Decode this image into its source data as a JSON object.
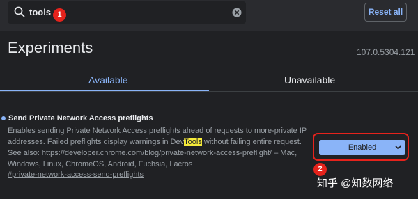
{
  "search": {
    "value": "tools"
  },
  "header": {
    "reset_label": "Reset all"
  },
  "annotations": {
    "badge_1": "1",
    "badge_2": "2"
  },
  "page": {
    "title": "Experiments",
    "version": "107.0.5304.121"
  },
  "tabs": [
    {
      "label": "Available",
      "active": true
    },
    {
      "label": "Unavailable",
      "active": false
    }
  ],
  "experiment": {
    "title": "Send Private Network Access preflights",
    "description_before": "Enables sending Private Network Access preflights ahead of requests to more-private IP addresses. Failed preflights display warnings in Dev",
    "description_highlight": "Tools",
    "description_after": " without failing entire request. See also: https://developer.chrome.com/blog/private-network-access-preflight/ – Mac, Windows, Linux, ChromeOS, Android, Fuchsia, Lacros",
    "link": "#private-network-access-send-preflights",
    "selected_option": "Enabled"
  },
  "watermark": "知乎 @知数网络",
  "colors": {
    "accent": "#8ab4f8",
    "background": "#202124",
    "annotation": "#e5231c",
    "highlight": "#f5ea3a"
  }
}
